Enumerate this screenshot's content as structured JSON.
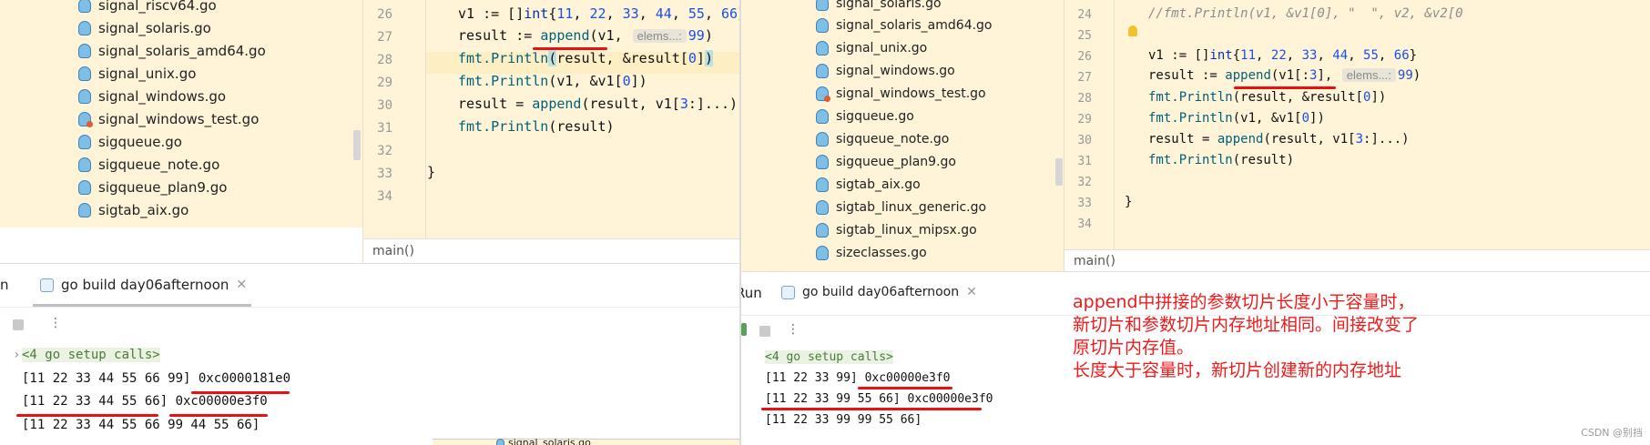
{
  "left": {
    "files": [
      {
        "name": "signal_riscv64.go",
        "warn": false
      },
      {
        "name": "signal_solaris.go",
        "warn": false
      },
      {
        "name": "signal_solaris_amd64.go",
        "warn": false
      },
      {
        "name": "signal_unix.go",
        "warn": false
      },
      {
        "name": "signal_windows.go",
        "warn": false
      },
      {
        "name": "signal_windows_test.go",
        "warn": true
      },
      {
        "name": "sigqueue.go",
        "warn": false
      },
      {
        "name": "sigqueue_note.go",
        "warn": false
      },
      {
        "name": "sigqueue_plan9.go",
        "warn": false
      },
      {
        "name": "sigtab_aix.go",
        "warn": false
      }
    ],
    "line_numbers": [
      "26",
      "27",
      "28",
      "29",
      "30",
      "31",
      "32",
      "33",
      "34"
    ],
    "code": {
      "l26": {
        "a": "v1 := []",
        "b": "int",
        "c": "{",
        "n1": "11",
        "s1": ", ",
        "n2": "22",
        "s2": ", ",
        "n3": "33",
        "s3": ", ",
        "n4": "44",
        "s4": ", ",
        "n5": "55",
        "s5": ", ",
        "n6": "66",
        "d": "}"
      },
      "l27": {
        "a": "result := ",
        "fn": "append",
        "b": "(v1, ",
        "hint": "elems...:",
        "n": "99",
        "c": ")"
      },
      "l28": {
        "fn": "fmt.Println",
        "p": "(",
        "b": "result, &result[",
        "n": "0",
        "c": "]",
        ")": ")"
      },
      "l29": {
        "fn": "fmt.Println",
        "b": "(v1, &v1[",
        "n": "0",
        "c": "])"
      },
      "l30": {
        "a": "result = ",
        "fn": "append",
        "b": "(result, v1[",
        "n": "3",
        "c": ":]...)"
      },
      "l31": {
        "fn": "fmt.Println",
        "b": "(result)"
      },
      "l33": "}"
    },
    "breadcrumb": "main()",
    "run_tab_prefix": "n",
    "run_tab": "go build day06afternoon",
    "console": {
      "setup": "<4 go setup calls>",
      "lines": [
        {
          "a": "[11 22 33 44 55 66 99] ",
          "b": "0xc0000181e0"
        },
        {
          "a": "[11 22 33 44 55 66] ",
          "b": "0xc00000e3f0"
        },
        {
          "a": "[11 22 33 44 55 66 99 44 55 66]",
          "b": ""
        }
      ]
    },
    "overlay_fragment": "signal_solaris.go"
  },
  "right": {
    "files": [
      {
        "name": "signal_solaris.go",
        "warn": false
      },
      {
        "name": "signal_solaris_amd64.go",
        "warn": false
      },
      {
        "name": "signal_unix.go",
        "warn": false
      },
      {
        "name": "signal_windows.go",
        "warn": false
      },
      {
        "name": "signal_windows_test.go",
        "warn": true
      },
      {
        "name": "sigqueue.go",
        "warn": false
      },
      {
        "name": "sigqueue_note.go",
        "warn": false
      },
      {
        "name": "sigqueue_plan9.go",
        "warn": false
      },
      {
        "name": "sigtab_aix.go",
        "warn": false
      },
      {
        "name": "sigtab_linux_generic.go",
        "warn": false
      },
      {
        "name": "sigtab_linux_mipsx.go",
        "warn": false
      },
      {
        "name": "sizeclasses.go",
        "warn": false
      }
    ],
    "line_numbers": [
      "24",
      "25",
      "26",
      "27",
      "28",
      "29",
      "30",
      "31",
      "32",
      "33",
      "34"
    ],
    "code": {
      "l24": "//fmt.Println(v1, &v1[0], \"  \", v2, &v2[0",
      "l26": {
        "a": "v1 := []",
        "b": "int",
        "c": "{",
        "n1": "11",
        "s1": ", ",
        "n2": "22",
        "s2": ", ",
        "n3": "33",
        "s3": ", ",
        "n4": "44",
        "s4": ", ",
        "n5": "55",
        "s5": ", ",
        "n6": "66",
        "d": "}"
      },
      "l27": {
        "a": "result := ",
        "fn": "append",
        "b": "(v1[:",
        "n": "3",
        "c": "], ",
        "hint": "elems...:",
        "n2": "99",
        "d": ")"
      },
      "l28": {
        "fn": "fmt.Println",
        "b": "(result, &result[",
        "n": "0",
        "c": "])"
      },
      "l29": {
        "fn": "fmt.Println",
        "b": "(v1, &v1[",
        "n": "0",
        "c": "])"
      },
      "l30": {
        "a": "result = ",
        "fn": "append",
        "b": "(result, v1[",
        "n": "3",
        "c": ":]...)"
      },
      "l31": {
        "fn": "fmt.Println",
        "b": "(result)"
      },
      "l33": "}"
    },
    "breadcrumb": "main()",
    "run_tab_prefix": "Run",
    "run_tab": "go build day06afternoon",
    "console": {
      "setup": "<4 go setup calls>",
      "lines": [
        {
          "a": "[11 22 33 99] ",
          "b": "0xc00000e3f0"
        },
        {
          "a": "[11 22 33 99 55 66] ",
          "b": "0xc00000e3f0"
        },
        {
          "a": "[11 22 33 99 99 55 66]",
          "b": ""
        }
      ]
    },
    "annotation": [
      "append中拼接的参数切片长度小于容量时，",
      "新切片和参数切片内存地址相同。间接改变了",
      "原切片内存值。",
      "长度大于容量时，新切片创建新的内存地址"
    ],
    "watermark": "CSDN @别挡"
  },
  "colors": {
    "accent_red": "#e81010",
    "tree_bg": "#fff3d8",
    "keyword": "#0033b3",
    "number": "#1750eb"
  }
}
